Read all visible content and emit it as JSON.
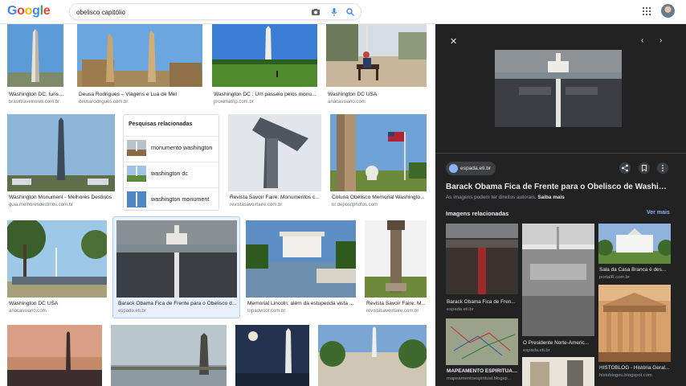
{
  "search": {
    "query": "obelisco capitólio"
  },
  "logo": {
    "letters": [
      "G",
      "o",
      "o",
      "g",
      "l",
      "e"
    ],
    "colors": [
      "#4285f4",
      "#ea4335",
      "#fbbc05",
      "#4285f4",
      "#34a853",
      "#ea4335"
    ]
  },
  "icons": {
    "camera": "camera-icon",
    "mic": "mic-icon",
    "search": "search-icon",
    "apps": "apps-grid-icon"
  },
  "results": [
    {
      "caption": "Washington DC, turism...",
      "source": "brasiltravelnews.com.br"
    },
    {
      "caption": "Deusa Rodrigues – Viagens e Lua de Mel",
      "source": "deusarodrigues.com.br"
    },
    {
      "caption": "Washington DC : Um passeio pelos monu...",
      "source": "proximatrip.com.br"
    },
    {
      "caption": "Washington DC USA",
      "source": "anacassiano.com"
    },
    {
      "caption": "Washington Monument - Melhores Destinos",
      "source": "guia.melhoresdestinos.com.br"
    },
    {
      "caption": "Revista Savoir Faire: Monumentos c...",
      "source": "revistasavoirfaire.com.br"
    },
    {
      "caption": "Coluna Obelisco Memorial Washingto...",
      "source": "br.depositphotos.com"
    },
    {
      "caption": "Washington DC USA",
      "source": "anacassiano.com"
    },
    {
      "caption": "Barack Obama Fica de Frente para o Obelisco d...",
      "source": "espada.eti.br"
    },
    {
      "caption": "Memorial Lincoln: além da estupenda vista ...",
      "source": "tripadvisor.com.br"
    },
    {
      "caption": "Revista Savoir Faire: M...",
      "source": "revistasavoirfaire.com.br"
    }
  ],
  "related_searches": {
    "title": "Pesquisas relacionadas",
    "items": [
      {
        "label": "monumento washington"
      },
      {
        "label": "washington dc"
      },
      {
        "label": "washington monument"
      }
    ]
  },
  "panel": {
    "site": "espada.eti.br",
    "title": "Barack Obama Fica de Frente para o Obelisco de Washin...",
    "rights": "As imagens podem ter direitos autorais.",
    "rights_link": "Saiba mais",
    "related_title": "Imagens relacionadas",
    "ver_mais": "Ver mais",
    "related": [
      {
        "caption": "Barack Obama Fica de Fren...",
        "source": "espada.eti.br"
      },
      {
        "caption": "O Presidente Norte-Americ...",
        "source": "espada.eti.br"
      },
      {
        "caption": "MAPEAMENTO ESPIRITUAL...",
        "source": "mapeamentoespiritual.blogsp..."
      },
      {
        "caption": "Sala da Casa Branca é des...",
        "source": "portalR.com.br"
      },
      {
        "caption": "HISTOBLOG - História Geral...",
        "source": "histoblogeu.blogspot.com"
      }
    ]
  }
}
